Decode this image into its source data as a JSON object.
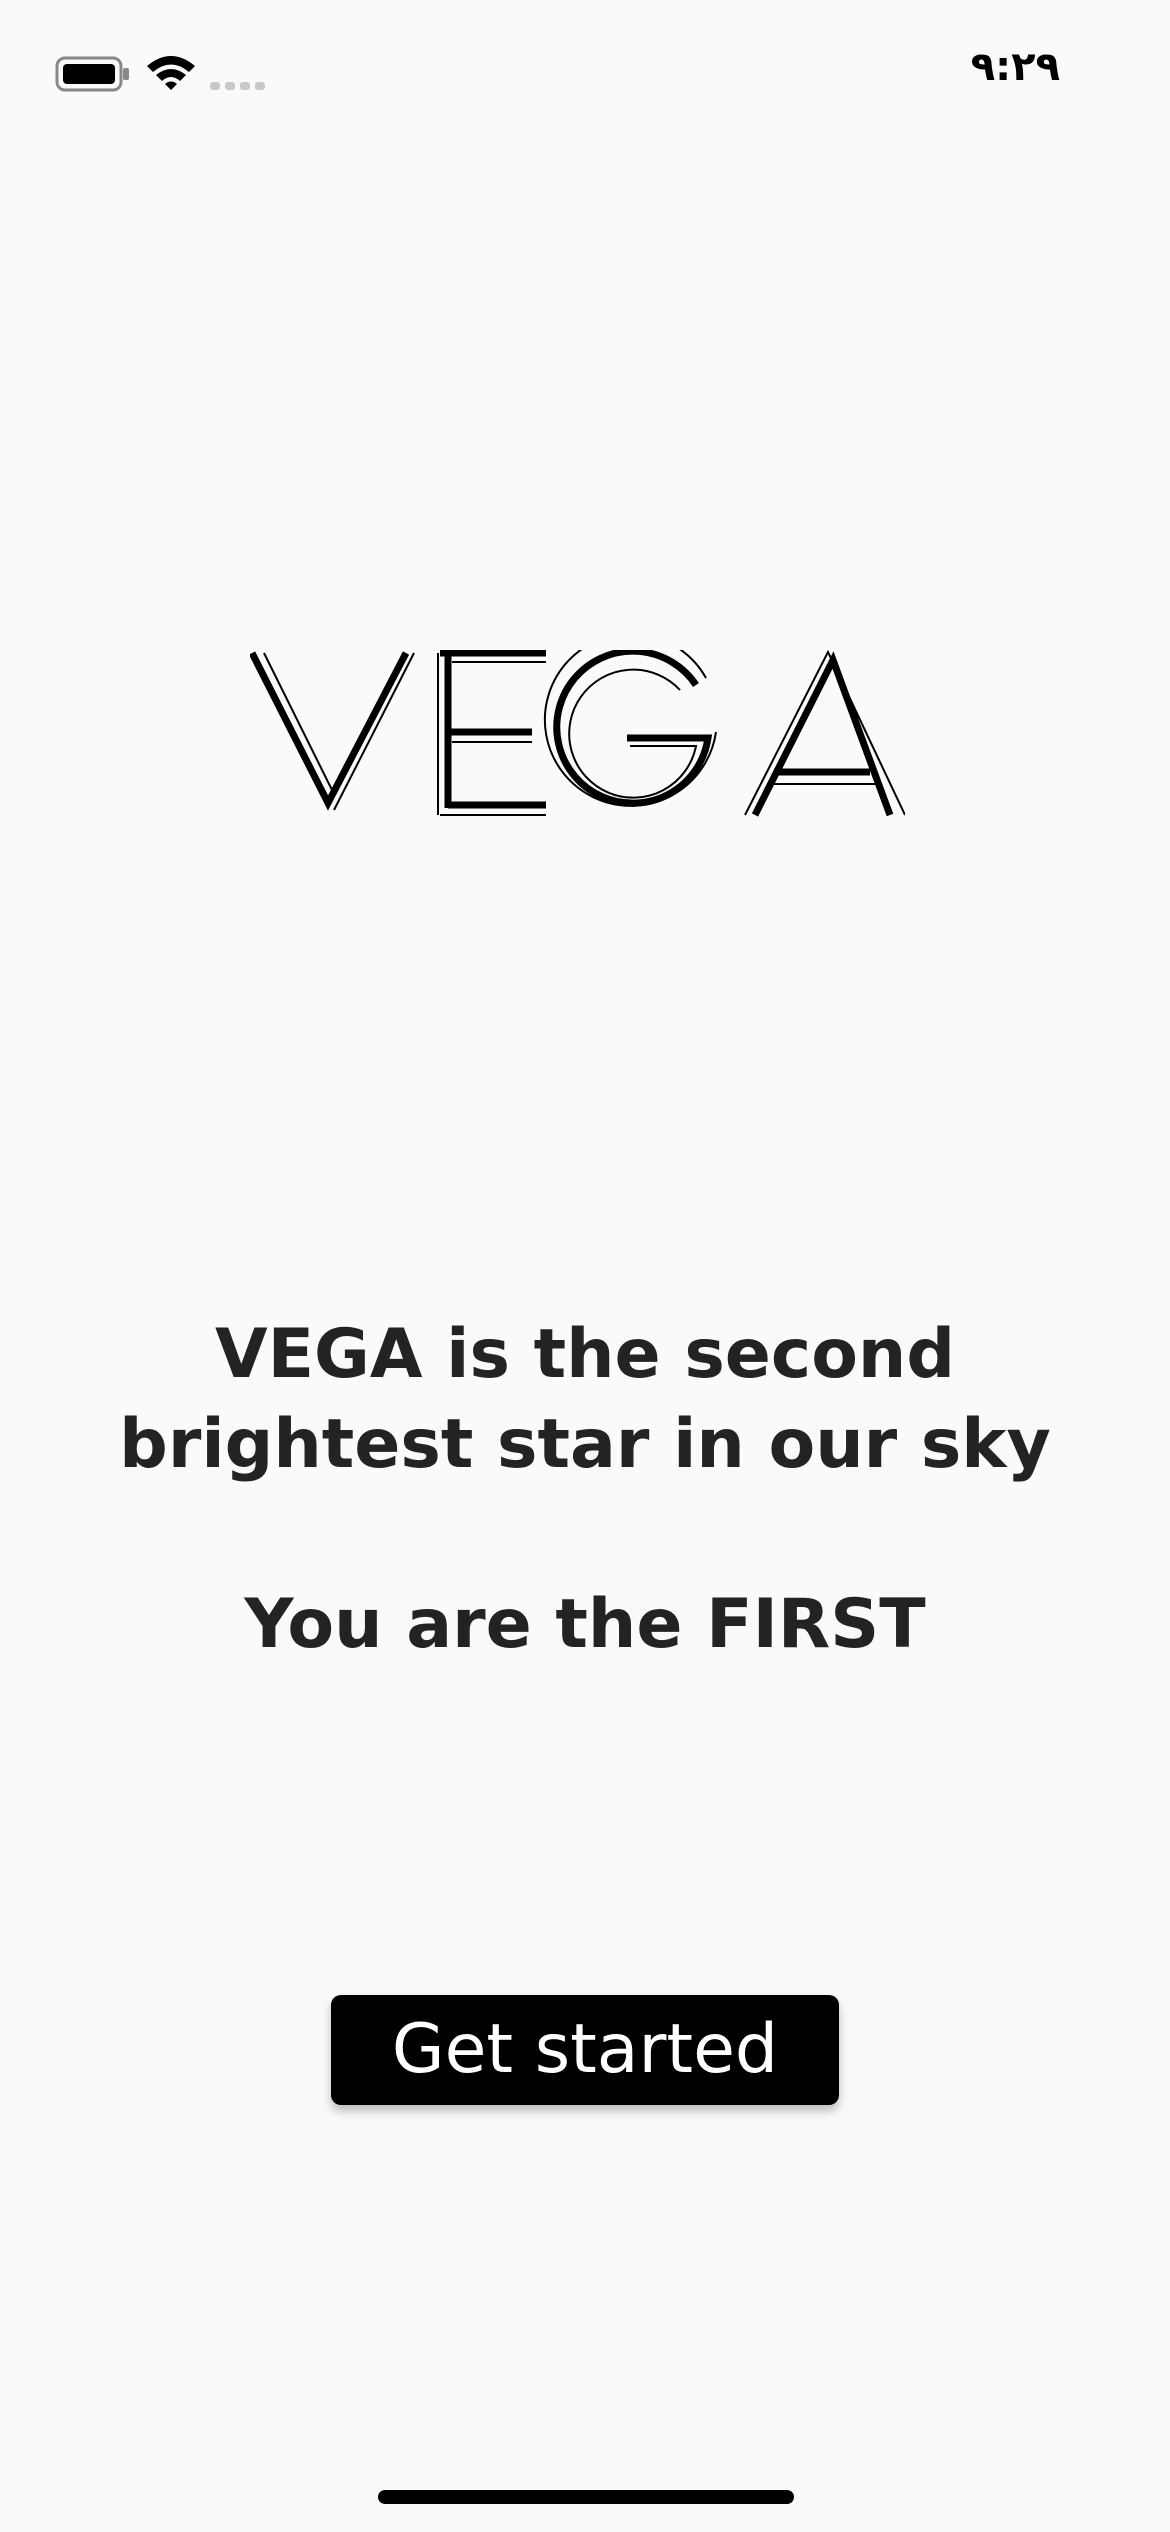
{
  "status_bar": {
    "time": "٩:٢٩",
    "icons": [
      "battery-icon",
      "wifi-icon",
      "cellular-signal-icon"
    ]
  },
  "logo": {
    "text": "VEGA"
  },
  "tagline": {
    "line1": "VEGA is the second",
    "line2": "brightest star in our sky",
    "line3": "You are the FIRST"
  },
  "cta": {
    "label": "Get started"
  },
  "colors": {
    "background": "#fafafa",
    "text": "#232323",
    "button_bg": "#000000",
    "button_text": "#ffffff"
  }
}
